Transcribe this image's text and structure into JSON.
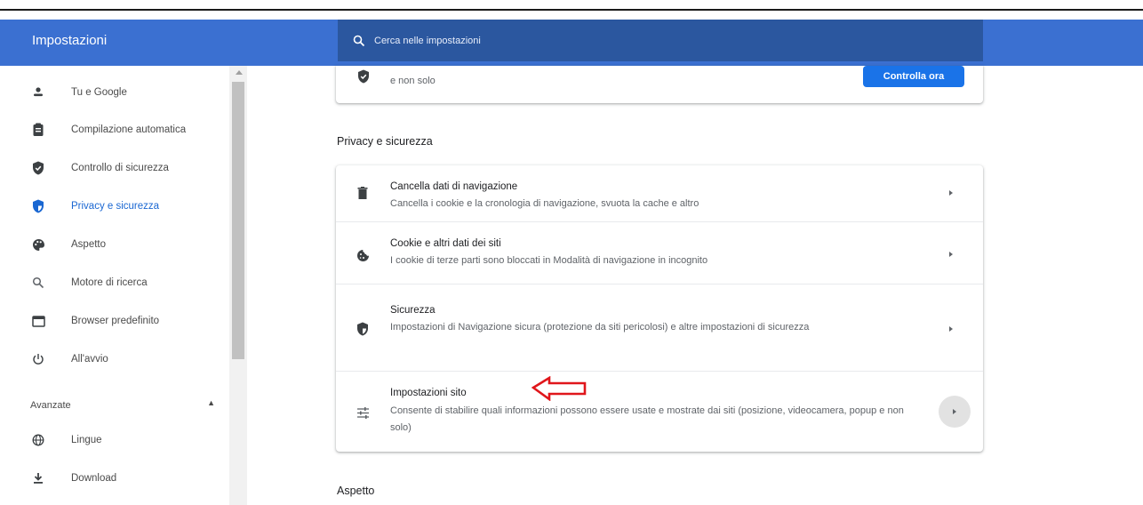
{
  "header": {
    "title": "Impostazioni",
    "search_placeholder": "Cerca nelle impostazioni"
  },
  "sidebar": {
    "items": [
      {
        "label": "Tu e Google",
        "icon": "person-icon"
      },
      {
        "label": "Compilazione automatica",
        "icon": "clipboard-icon"
      },
      {
        "label": "Controllo di sicurezza",
        "icon": "shield-check-icon"
      },
      {
        "label": "Privacy e sicurezza",
        "icon": "privacy-shield-icon",
        "active": true
      },
      {
        "label": "Aspetto",
        "icon": "palette-icon"
      },
      {
        "label": "Motore di ricerca",
        "icon": "search-icon"
      },
      {
        "label": "Browser predefinito",
        "icon": "browser-window-icon"
      },
      {
        "label": "All'avvio",
        "icon": "power-icon"
      }
    ],
    "advanced_label": "Avanzate",
    "advanced_items": [
      {
        "label": "Lingue",
        "icon": "globe-icon"
      },
      {
        "label": "Download",
        "icon": "download-icon"
      }
    ]
  },
  "safety_check": {
    "text": "e non solo",
    "button_label": "Controlla ora"
  },
  "privacy_section": {
    "title": "Privacy e sicurezza",
    "rows": [
      {
        "title": "Cancella dati di navigazione",
        "subtitle": "Cancella i cookie e la cronologia di navigazione, svuota la cache e altro",
        "icon": "trash-icon"
      },
      {
        "title": "Cookie e altri dati dei siti",
        "subtitle": "I cookie di terze parti sono bloccati in Modalità di navigazione in incognito",
        "icon": "cookie-icon"
      },
      {
        "title": "Sicurezza",
        "subtitle": "Impostazioni di Navigazione sicura (protezione da siti pericolosi) e altre impostazioni di sicurezza",
        "icon": "security-shield-icon"
      },
      {
        "title": "Impostazioni sito",
        "subtitle": "Consente di stabilire quali informazioni possono essere usate e mostrate dai siti (posizione, videocamera, popup e non solo)",
        "icon": "sliders-icon"
      }
    ]
  },
  "next_section": {
    "title": "Aspetto"
  },
  "colors": {
    "header_bg": "#3b70d1",
    "search_bg": "#2b579f",
    "accent": "#1a73e8",
    "annotation_arrow": "#e0161b"
  }
}
